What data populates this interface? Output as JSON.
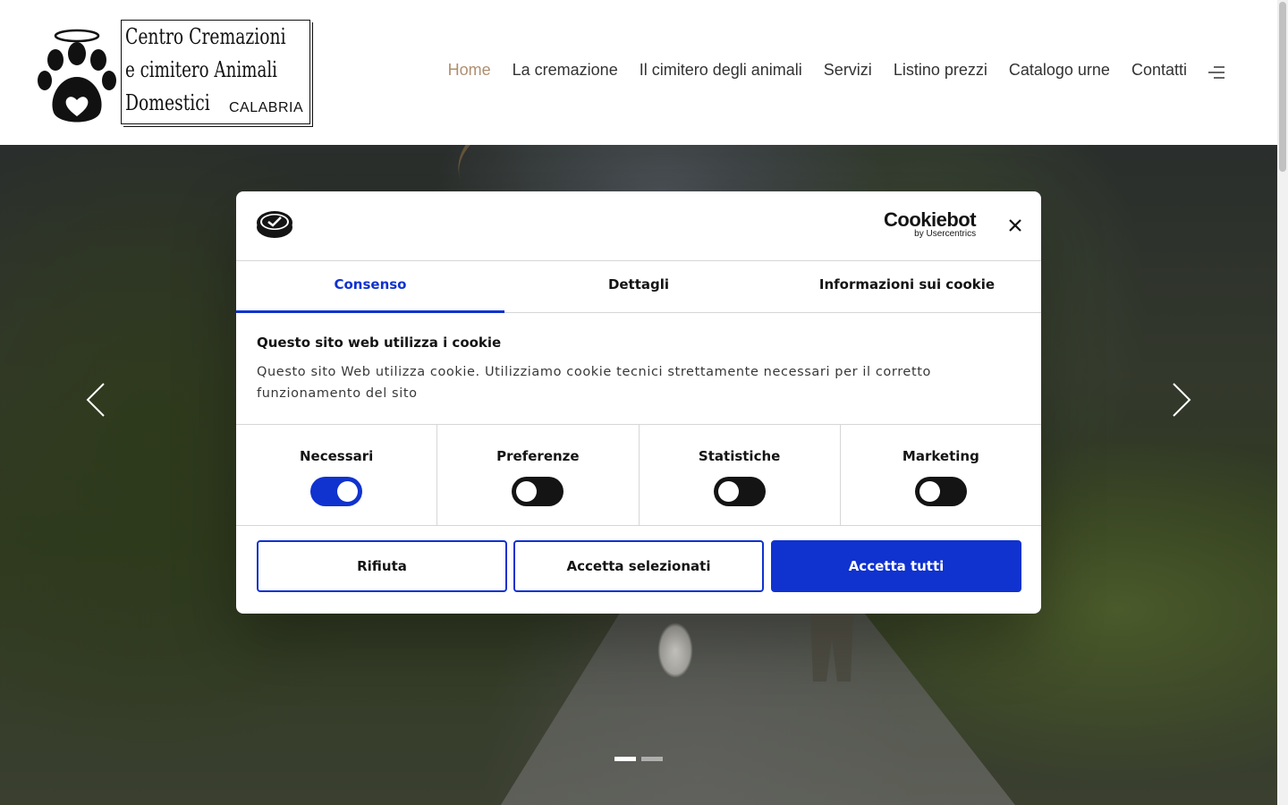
{
  "header": {
    "logo": {
      "line1": "Centro Cremazioni",
      "line2": "e cimitero Animali",
      "line3": "Domestici",
      "region": "CALABRIA"
    },
    "nav": [
      {
        "label": "Home",
        "active": true
      },
      {
        "label": "La cremazione",
        "active": false
      },
      {
        "label": "Il cimitero degli animali",
        "active": false
      },
      {
        "label": "Servizi",
        "active": false
      },
      {
        "label": "Listino prezzi",
        "active": false
      },
      {
        "label": "Catalogo urne",
        "active": false
      },
      {
        "label": "Contatti",
        "active": false
      }
    ],
    "menu_icon": "menu-lines-icon",
    "active_color": "#b08e6e"
  },
  "hero": {
    "slides_total": 2,
    "active_slide": 1,
    "prev_icon": "chevron-left-icon",
    "next_icon": "chevron-right-icon"
  },
  "cookie_dialog": {
    "brand": {
      "name": "Cookiebot",
      "sub": "by Usercentrics"
    },
    "close_icon": "close-icon",
    "tabs": [
      {
        "label": "Consenso",
        "active": true
      },
      {
        "label": "Dettagli",
        "active": false
      },
      {
        "label": "Informazioni sui cookie",
        "active": false
      }
    ],
    "title": "Questo sito web utilizza i cookie",
    "text": "Questo sito Web utilizza cookie. Utilizziamo cookie tecnici strettamente necessari per il corretto funzionamento del sito",
    "toggles": [
      {
        "label": "Necessari",
        "on": true
      },
      {
        "label": "Preferenze",
        "on": false
      },
      {
        "label": "Statistiche",
        "on": false
      },
      {
        "label": "Marketing",
        "on": false
      }
    ],
    "buttons": {
      "reject": "Rifiuta",
      "accept_selected": "Accetta selezionati",
      "accept_all": "Accetta tutti"
    },
    "accent_color": "#1032cf"
  }
}
